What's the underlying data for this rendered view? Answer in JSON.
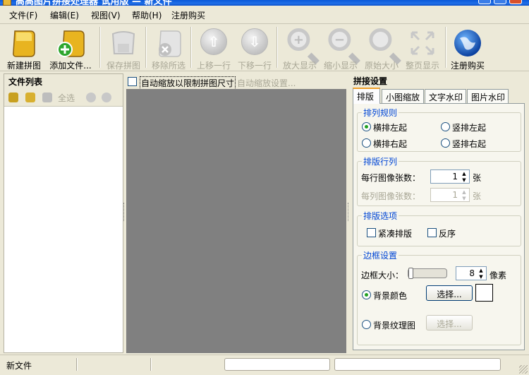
{
  "window": {
    "title": "高高图片拼接处理器 试用版 — 新文件"
  },
  "menu": [
    "文件(F)",
    "编辑(E)",
    "视图(V)",
    "帮助(H)",
    "注册购买"
  ],
  "toolbar": {
    "new": "新建拼图",
    "add": "添加文件...",
    "save": "保存拼图",
    "remove": "移除所选",
    "up": "上移一行",
    "down": "下移一行",
    "zoom_in": "放大显示",
    "zoom_out": "缩小显示",
    "original": "原始大小",
    "fit": "整页显示",
    "register": "注册购买"
  },
  "file_list": {
    "title": "文件列表",
    "select_all": "全选"
  },
  "main": {
    "auto_zoom_label": "自动缩放以限制拼图尺寸",
    "auto_zoom_settings": "自动缩放设置..."
  },
  "settings": {
    "title": "拼接设置",
    "tabs": [
      "排版",
      "小图缩放",
      "文字水印",
      "图片水印"
    ],
    "arrange_rule": {
      "title": "排列规则",
      "options": [
        "横排左起",
        "竖排左起",
        "横排右起",
        "竖排右起"
      ],
      "selected": "横排左起"
    },
    "rows_cols": {
      "title": "排版行列",
      "per_row_label": "每行图像张数：",
      "per_row_value": "1",
      "per_col_label": "每列图像张数：",
      "per_col_value": "1",
      "unit": "张"
    },
    "layout_options": {
      "title": "排版选项",
      "compact": "紧凑排版",
      "reverse": "反序"
    },
    "border": {
      "title": "边框设置",
      "size_label": "边框大小：",
      "size_value": "8",
      "size_unit": "像素",
      "slider_level": 0,
      "bg_color": "背景颜色",
      "bg_texture": "背景纹理图",
      "select_btn": "选择...",
      "swatch_color": "#ffffff"
    }
  },
  "status": {
    "text": "新文件"
  },
  "colors": {
    "accent": "#0046d5",
    "canvas": "#808080",
    "panel": "#ece9d8"
  }
}
